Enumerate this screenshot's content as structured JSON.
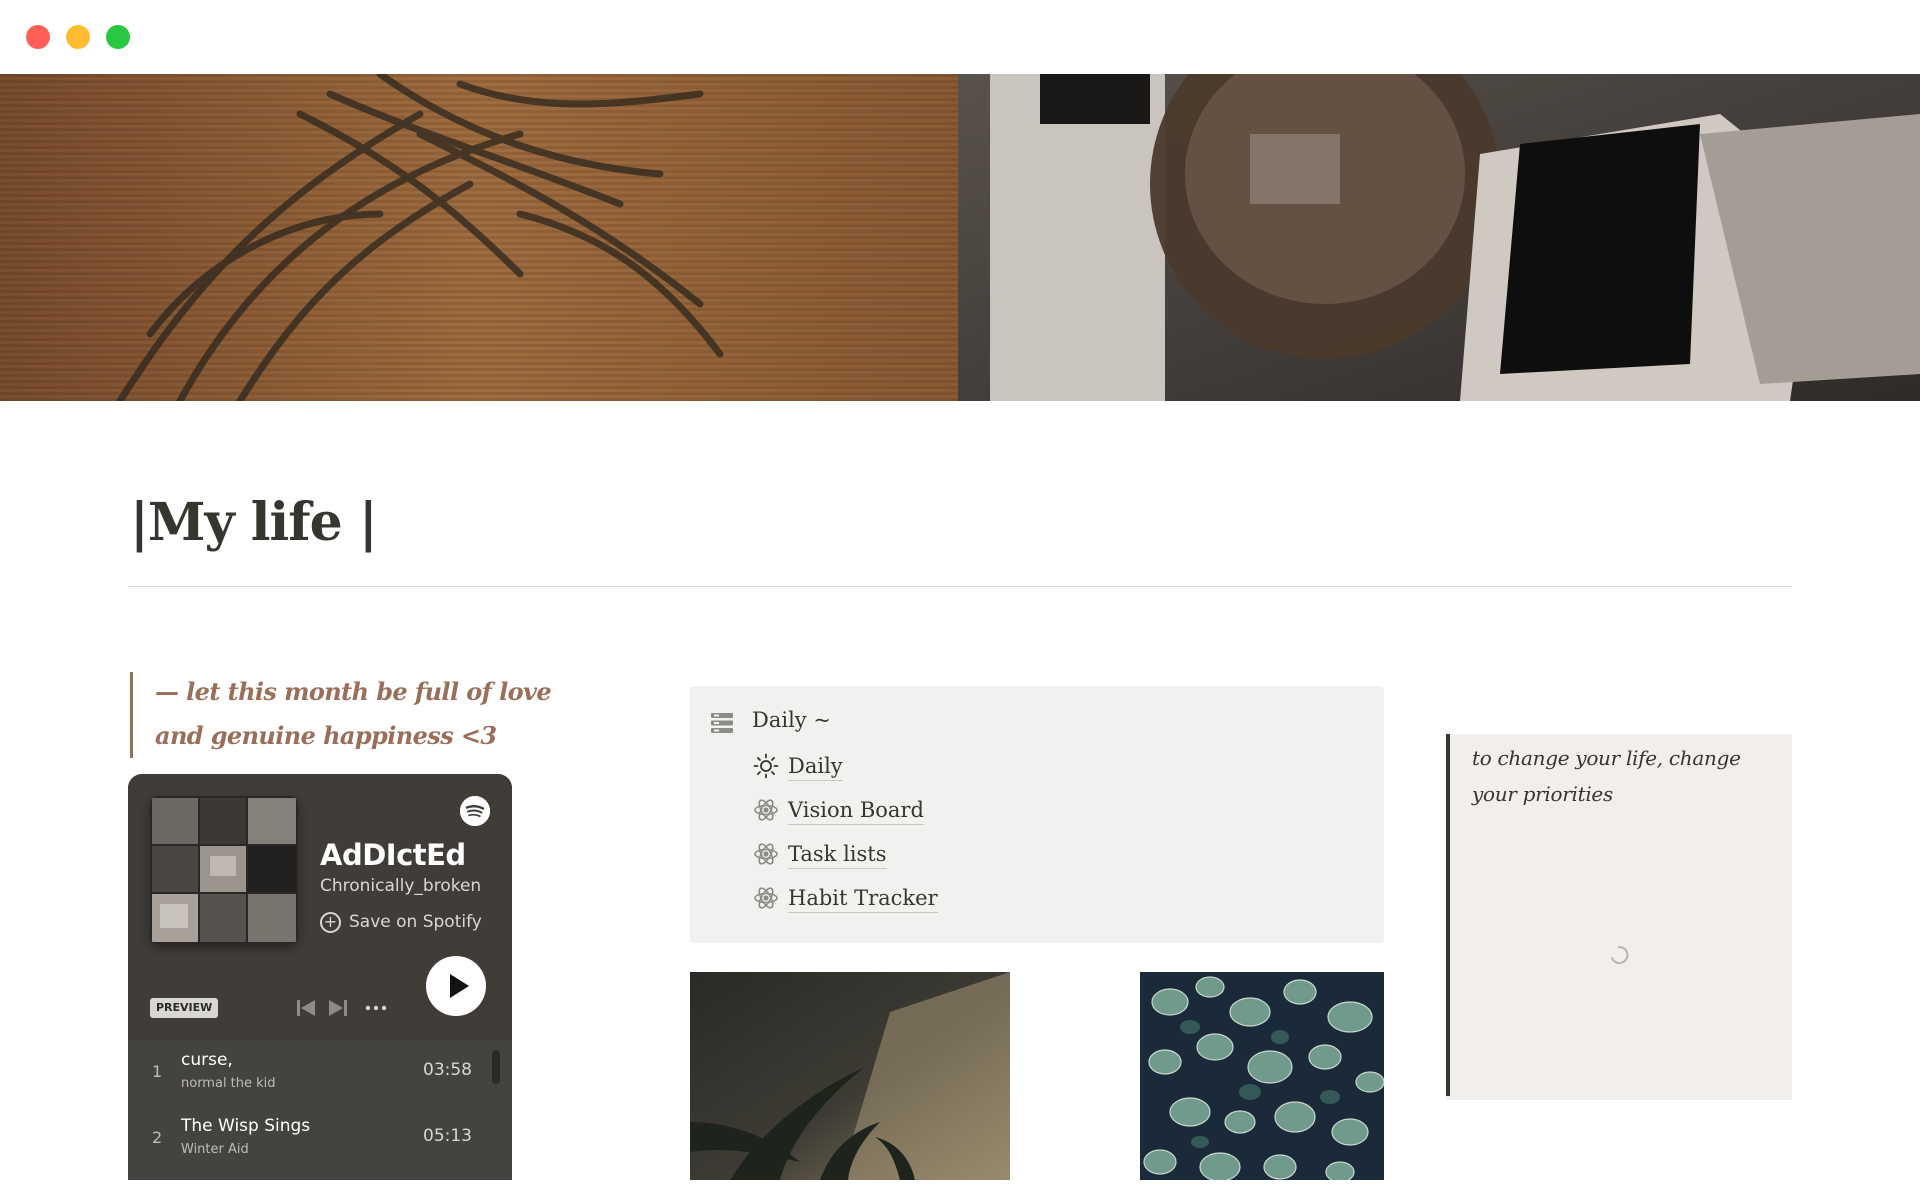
{
  "page": {
    "title": "|My life |"
  },
  "quote_left": {
    "text": "— let this month be full of love and genuine happiness <3"
  },
  "spotify": {
    "playlist_name": "AdDIctEd",
    "owner": "Chronically_broken",
    "save_label": "Save on Spotify",
    "preview_badge": "PREVIEW",
    "tracks": [
      {
        "number": "1",
        "title": "curse,",
        "artist": "normal the kid",
        "duration": "03:58"
      },
      {
        "number": "2",
        "title": "The Wisp Sings",
        "artist": "Winter Aid",
        "duration": "05:13"
      }
    ],
    "icons": [
      "spotify-logo-icon",
      "plus-circle-icon",
      "skip-back-icon",
      "skip-forward-icon",
      "more-icon",
      "play-icon"
    ]
  },
  "callout": {
    "title": "Daily ~",
    "icon": "database-icon",
    "items": [
      {
        "label": "Daily",
        "icon": "sun-icon"
      },
      {
        "label": "Vision Board",
        "icon": "atom-icon"
      },
      {
        "label": "Task lists",
        "icon": "atom-icon"
      },
      {
        "label": "Habit Tracker",
        "icon": "atom-icon"
      }
    ]
  },
  "quote_right": {
    "text": "to change your life, change your priorities"
  },
  "colors": {
    "accent": "#9a6e59",
    "text": "#37352f",
    "callout_bg": "#f1f1ef",
    "quote_bg": "#f1eeeb",
    "spotify_bg": "#45433f"
  }
}
